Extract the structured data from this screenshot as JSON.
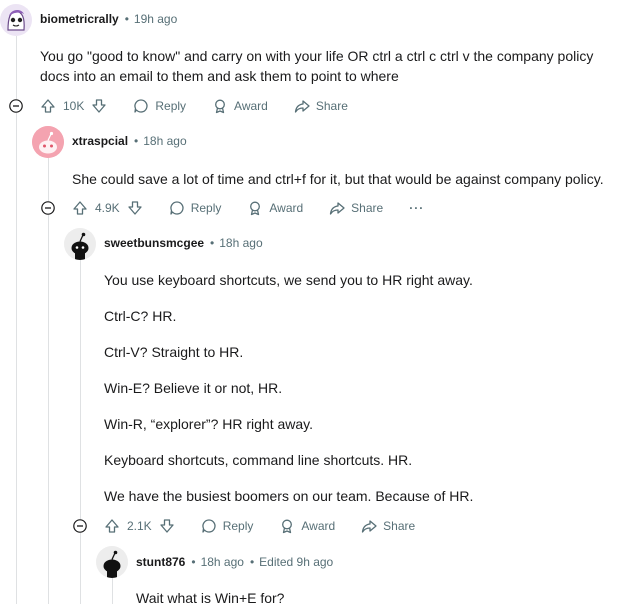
{
  "comments": [
    {
      "username": "biometricrally",
      "time": "19h ago",
      "body": [
        "You go \"good to know\" and carry on with your life OR ctrl a ctrl c ctrl v the company policy docs into an email to them and ask them to point to where"
      ],
      "votes": "10K"
    },
    {
      "username": "xtraspcial",
      "time": "18h ago",
      "body": [
        "She could save a lot of time and ctrl+f for it, but that would be against company policy."
      ],
      "votes": "4.9K"
    },
    {
      "username": "sweetbunsmcgee",
      "time": "18h ago",
      "body": [
        "You use keyboard shortcuts, we send you to HR right away.",
        "Ctrl-C? HR.",
        "Ctrl-V? Straight to HR.",
        "Win-E? Believe it or not, HR.",
        "Win-R, “explorer”? HR right away.",
        "Keyboard shortcuts, command line shortcuts. HR.",
        "We have the busiest boomers on our team. Because of HR."
      ],
      "votes": "2.1K"
    },
    {
      "username": "stunt876",
      "time": "18h ago",
      "edited": "Edited 9h ago",
      "body": [
        "Wait what is Win+E for?"
      ]
    }
  ],
  "labels": {
    "reply": "Reply",
    "award": "Award",
    "share": "Share",
    "more": "···",
    "separator": "•"
  },
  "colors": {
    "meta": "#576f76",
    "line": "#dfe1e3",
    "text": "#1a1a1b"
  }
}
